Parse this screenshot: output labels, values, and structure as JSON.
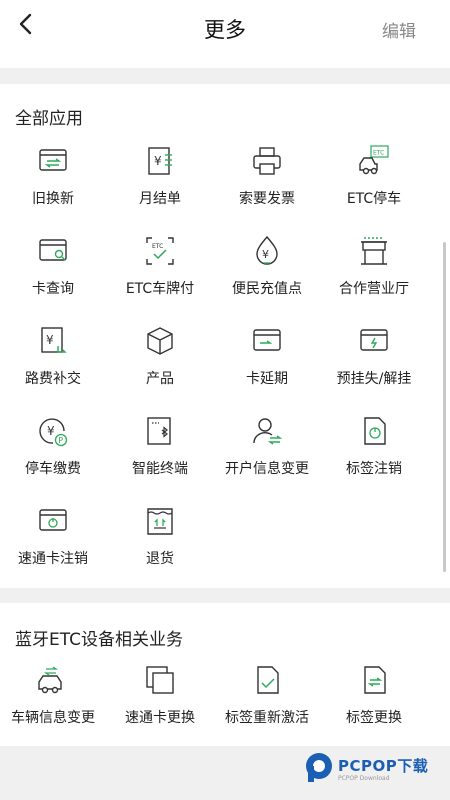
{
  "header": {
    "title": "更多",
    "edit_label": "编辑",
    "back_icon": "chevron-left-icon"
  },
  "section_all": {
    "title": "全部应用",
    "items": [
      {
        "label": "旧换新",
        "icon": "card-exchange-icon"
      },
      {
        "label": "月结单",
        "icon": "bill-icon"
      },
      {
        "label": "索要发票",
        "icon": "printer-icon"
      },
      {
        "label": "ETC停车",
        "icon": "etc-car-icon"
      },
      {
        "label": "卡查询",
        "icon": "card-search-icon"
      },
      {
        "label": "ETC车牌付",
        "icon": "etc-scan-icon"
      },
      {
        "label": "便民充值点",
        "icon": "location-yen-icon"
      },
      {
        "label": "合作营业厅",
        "icon": "store-icon"
      },
      {
        "label": "路费补交",
        "icon": "toll-payment-icon"
      },
      {
        "label": "产品",
        "icon": "box-icon"
      },
      {
        "label": "卡延期",
        "icon": "card-extend-icon"
      },
      {
        "label": "预挂失/解挂",
        "icon": "card-lock-icon"
      },
      {
        "label": "停车缴费",
        "icon": "parking-fee-icon"
      },
      {
        "label": "智能终端",
        "icon": "bluetooth-device-icon"
      },
      {
        "label": "开户信息变更",
        "icon": "user-change-icon"
      },
      {
        "label": "标签注销",
        "icon": "tag-cancel-icon"
      },
      {
        "label": "速通卡注销",
        "icon": "card-cancel-icon"
      },
      {
        "label": "退货",
        "icon": "return-box-icon"
      }
    ]
  },
  "section_bt": {
    "title": "蓝牙ETC设备相关业务",
    "items": [
      {
        "label": "车辆信息变更",
        "icon": "car-change-icon"
      },
      {
        "label": "速通卡更换",
        "icon": "card-replace-icon"
      },
      {
        "label": "标签重新激活",
        "icon": "tag-activate-icon"
      },
      {
        "label": "标签更换",
        "icon": "tag-replace-icon"
      }
    ]
  },
  "watermark": {
    "text": "PCPOP下载",
    "sub": "PCPOP Download"
  },
  "colors": {
    "accent": "#2faa5a",
    "line": "#333333"
  }
}
